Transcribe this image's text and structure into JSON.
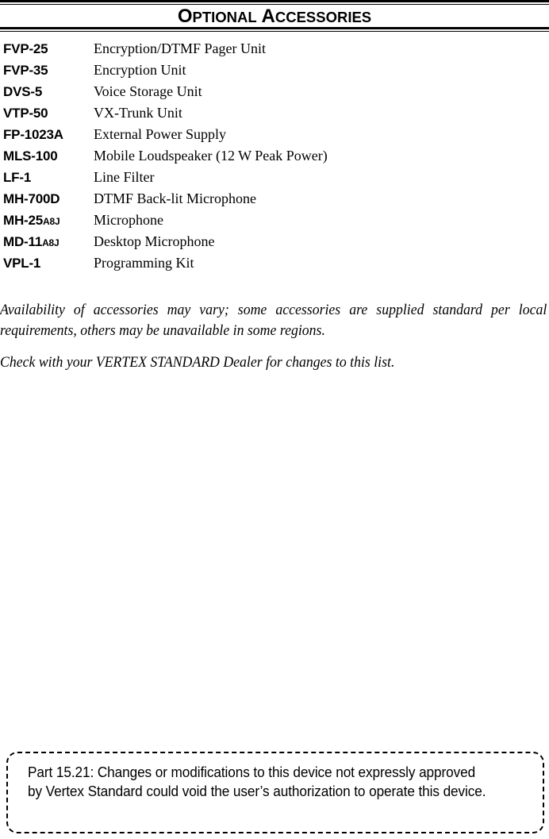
{
  "document": {
    "section_title": {
      "word1_initial": "O",
      "word1_rest": "PTIONAL",
      "word2_initial": "A",
      "word2_rest": "CCESSORIES",
      "plain": "Optional Accessories"
    },
    "accessories": [
      {
        "model": "FVP-25",
        "suffix": "",
        "description": "Encryption/DTMF Pager Unit"
      },
      {
        "model": "FVP-35",
        "suffix": "",
        "description": "Encryption Unit"
      },
      {
        "model": "DVS-5",
        "suffix": "",
        "description": "Voice Storage Unit"
      },
      {
        "model": "VTP-50",
        "suffix": "",
        "description": "VX-Trunk Unit"
      },
      {
        "model": "FP-1023A",
        "suffix": "",
        "description": "External Power Supply"
      },
      {
        "model": "MLS-100",
        "suffix": "",
        "description": "Mobile Loudspeaker (12 W Peak Power)"
      },
      {
        "model": "LF-1",
        "suffix": "",
        "description": "Line Filter"
      },
      {
        "model": "MH-700D",
        "suffix": "",
        "description": "DTMF Back-lit Microphone"
      },
      {
        "model": "MH-25",
        "suffix": "A8J",
        "description": "Microphone"
      },
      {
        "model": "MD-11",
        "suffix": "A8J",
        "description": "Desktop Microphone"
      },
      {
        "model": "VPL-1",
        "suffix": "",
        "description": "Programming Kit"
      }
    ],
    "notes": {
      "availability": "Availability of accessories may vary; some accessories are supplied standard per local requirements, others may be unavailable in some regions.",
      "dealer": "Check with your VERTEX STANDARD Dealer for changes to this list."
    },
    "notice": {
      "text": "Part 15.21:  Changes or modifications to this device not expressly approved by Vertex Standard could void the user’s authorization to operate this device."
    },
    "colors": {
      "text": "#000000",
      "background": "#ffffff",
      "rule": "#000000"
    }
  }
}
